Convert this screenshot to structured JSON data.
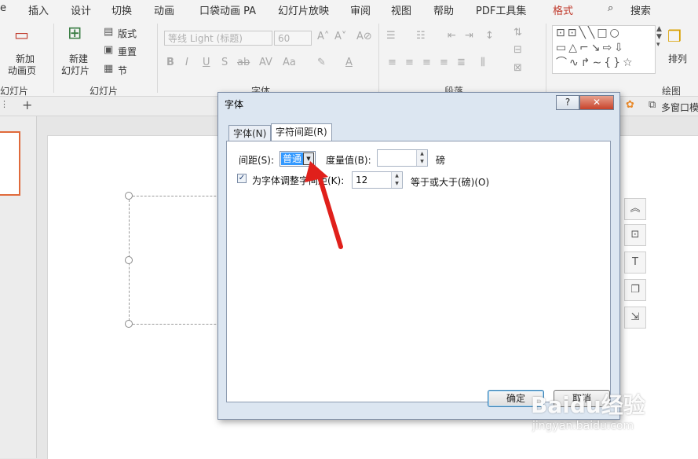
{
  "tabs": [
    "e",
    "插入",
    "设计",
    "切换",
    "动画",
    "口袋动画 PA",
    "幻灯片放映",
    "审阅",
    "视图",
    "帮助",
    "PDF工具集",
    "格式"
  ],
  "search_label": "搜索",
  "ribbon": {
    "new_slide_left": [
      "新加",
      "动画页"
    ],
    "new_slide": [
      "新建",
      "幻灯片"
    ],
    "layout": "版式",
    "reset": "重置",
    "section": "节",
    "font_name": "等线 Light (标题)",
    "font_size": "60",
    "arrange": "排列",
    "groups": {
      "left": "幻灯片",
      "slides": "幻灯片",
      "font": "字体",
      "paragraph": "段落",
      "drawing": "绘图"
    }
  },
  "row2": {
    "multi_window": "多窗口模"
  },
  "dialog": {
    "title": "字体",
    "help_btn": "?",
    "close_btn": "✕",
    "tabs": [
      "字体(N)",
      "字符间距(R)"
    ],
    "spacing_label": "间距(S):",
    "spacing_value": "普通",
    "by_label": "度量值(B):",
    "by_value": "",
    "by_unit": "磅",
    "kerning_label": "为字体调整字间距(K):",
    "kerning_checked": true,
    "kerning_value": "12",
    "kerning_suffix": "等于或大于(磅)(O)",
    "ok": "确定",
    "cancel": "取消"
  },
  "watermark": {
    "brand": "Baidu经验",
    "url": "jingyan.baidu.com"
  },
  "colors": {
    "accent_tab": "#c0392b",
    "arrow": "#e0201b",
    "thumb_border": "#e06a3b",
    "dialog_bg": "#dce6f1"
  }
}
